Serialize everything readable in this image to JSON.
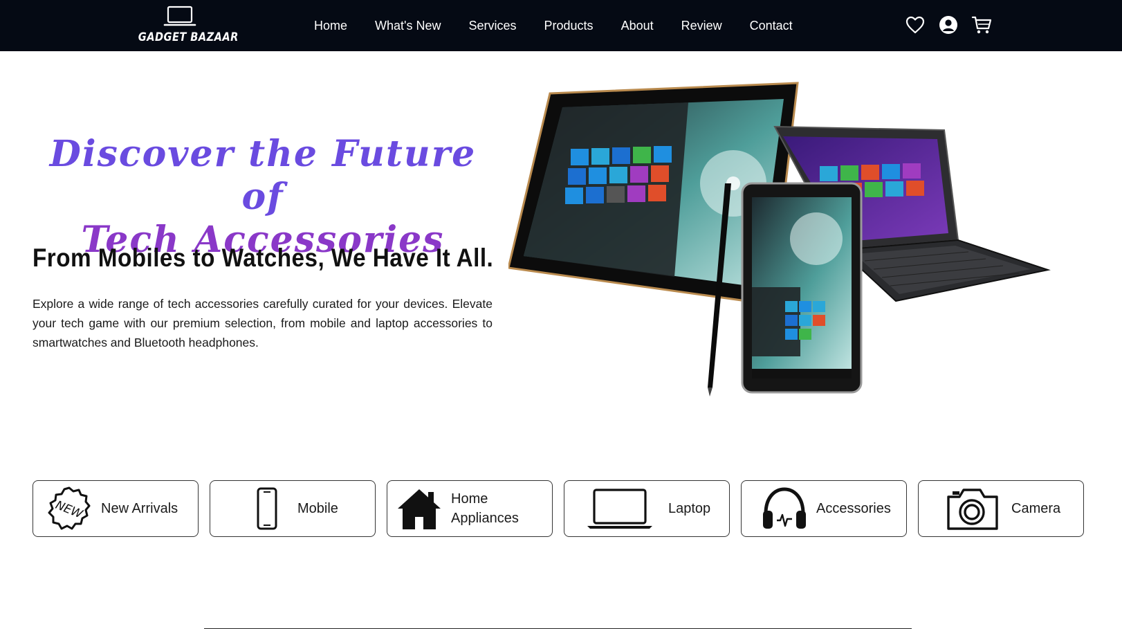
{
  "brand": {
    "name": "GADGET BAZAAR",
    "icon": "laptop-icon"
  },
  "nav": {
    "links": [
      "Home",
      "What's New",
      "Services",
      "Products",
      "About",
      "Review",
      "Contact"
    ],
    "icons": [
      "heart-icon",
      "user-icon",
      "cart-icon"
    ]
  },
  "hero": {
    "headline_line1": "Discover the Future of",
    "headline_line2": "Tech Accessories",
    "subtitle": "From Mobiles to Watches, We Have It All.",
    "description": "Explore a wide range of tech accessories carefully curated for your devices. Elevate your tech game with our premium selection, from mobile and laptop accessories to smartwatches and Bluetooth headphones.",
    "image_icon": "tablets-laptop-image",
    "tile_colors": [
      "#1f8fe0",
      "#2aa7d8",
      "#e04e2a",
      "#3fb54a",
      "#a03cc0",
      "#1c6fd0"
    ]
  },
  "categories": [
    {
      "label": "New Arrivals",
      "icon": "new-badge-icon"
    },
    {
      "label": "Mobile",
      "icon": "mobile-icon"
    },
    {
      "label": "Home Appliances",
      "icon": "home-icon"
    },
    {
      "label": "Laptop",
      "icon": "laptop-icon"
    },
    {
      "label": "Accessories",
      "icon": "headphones-icon"
    },
    {
      "label": "Camera",
      "icon": "camera-icon"
    }
  ],
  "colors": {
    "navbar_bg": "#050a14",
    "headline_purple": "#6a4be0",
    "headline_violet": "#8a38c8"
  }
}
